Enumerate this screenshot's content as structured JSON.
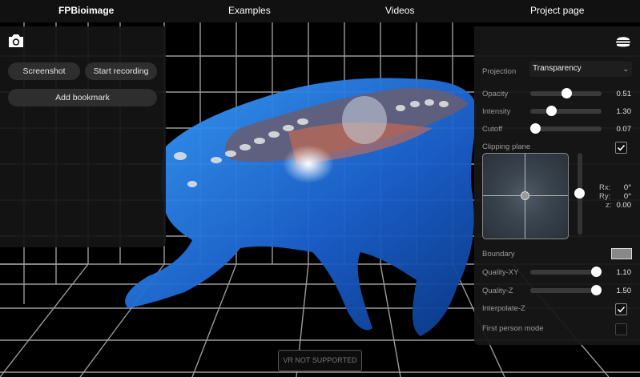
{
  "nav": {
    "brand": "FPBioimage",
    "examples": "Examples",
    "videos": "Videos",
    "project_page": "Project page"
  },
  "left_panel": {
    "camera_icon": "camera-icon",
    "screenshot_label": "Screenshot",
    "record_label": "Start recording",
    "bookmark_label": "Add bookmark"
  },
  "right_panel": {
    "menu_icon": "hamburger-menu-icon",
    "projection": {
      "label": "Projection",
      "value": "Transparency"
    },
    "opacity": {
      "label": "Opacity",
      "value": "0.51",
      "fraction": 0.51
    },
    "intensity": {
      "label": "Intensity",
      "value": "1.30",
      "fraction": 0.3
    },
    "cutoff": {
      "label": "Cutoff",
      "value": "0.07",
      "fraction": 0.07
    },
    "clipping_plane": {
      "label": "Clipping plane",
      "checked": true,
      "rx_label": "Rx:",
      "rx_value": "0°",
      "ry_label": "Ry:",
      "ry_value": "0°",
      "z_label": "z:",
      "z_value": "0.00"
    },
    "boundary": {
      "label": "Boundary",
      "color": "#888888"
    },
    "quality_xy": {
      "label": "Quality-XY",
      "value": "1.10",
      "fraction": 0.93
    },
    "quality_z": {
      "label": "Quality-Z",
      "value": "1.50",
      "fraction": 0.93
    },
    "interpolate_z": {
      "label": "Interpolate-Z",
      "checked": true
    },
    "first_person": {
      "label": "First person mode",
      "checked": false
    }
  },
  "vr_button": "VR NOT SUPPORTED",
  "colors": {
    "specimen_blue": "#1f6fd6",
    "grid": "#9a9a9a",
    "panel": "#161616"
  }
}
